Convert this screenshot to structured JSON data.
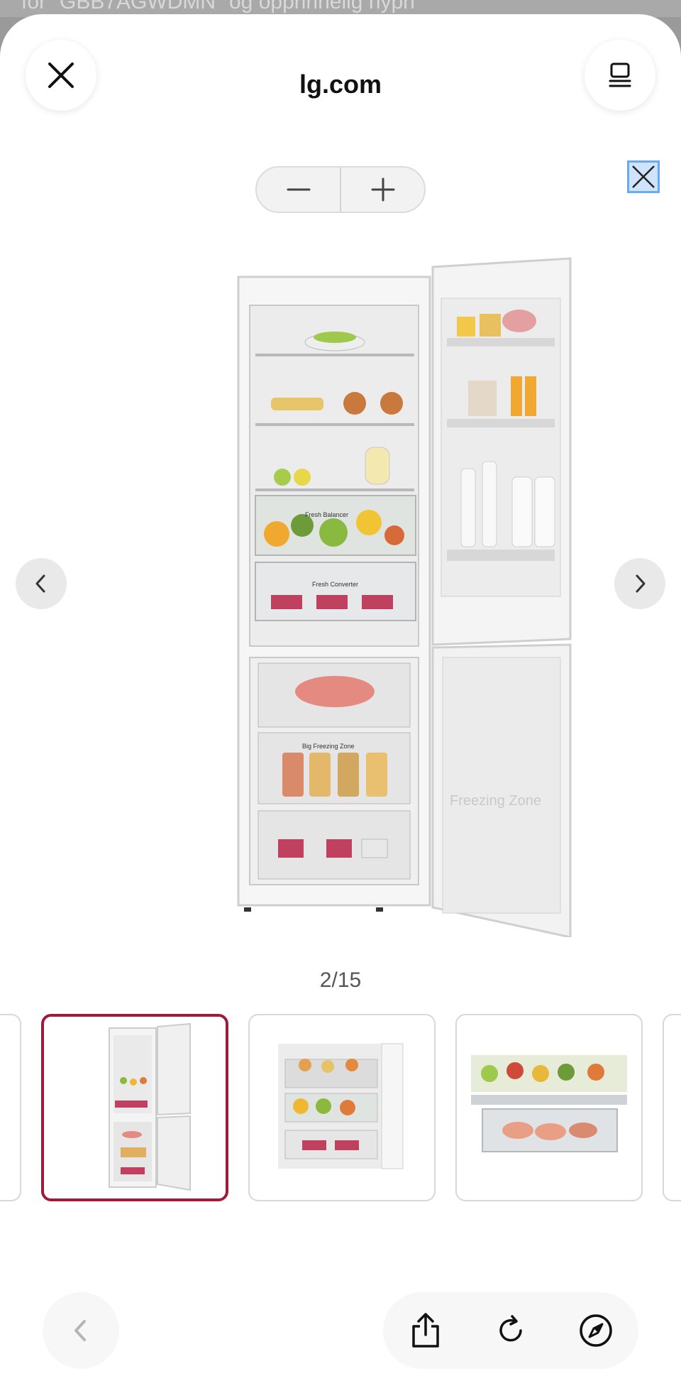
{
  "background": {
    "partial_text": "for \"GBB7AGWDMN\" og opprinnelig hypn"
  },
  "header": {
    "title": "lg.com",
    "close_icon": "close-icon",
    "tabs_icon": "tabs-icon"
  },
  "zoom": {
    "minus_icon": "minus-icon",
    "plus_icon": "plus-icon"
  },
  "viewer": {
    "counter": "2/15",
    "current": 2,
    "total": 15,
    "image_labels": [
      "Fresh Balancer",
      "Fresh Converter",
      "Big Freezing Zone",
      "Freezing Zone"
    ]
  },
  "toolbar": {
    "back_icon": "chevron-left-icon",
    "share_icon": "share-icon",
    "reload_icon": "reload-icon",
    "safari_icon": "compass-icon"
  },
  "colors": {
    "accent": "#9e1b3a",
    "close_box_border": "#6aaaf2"
  }
}
